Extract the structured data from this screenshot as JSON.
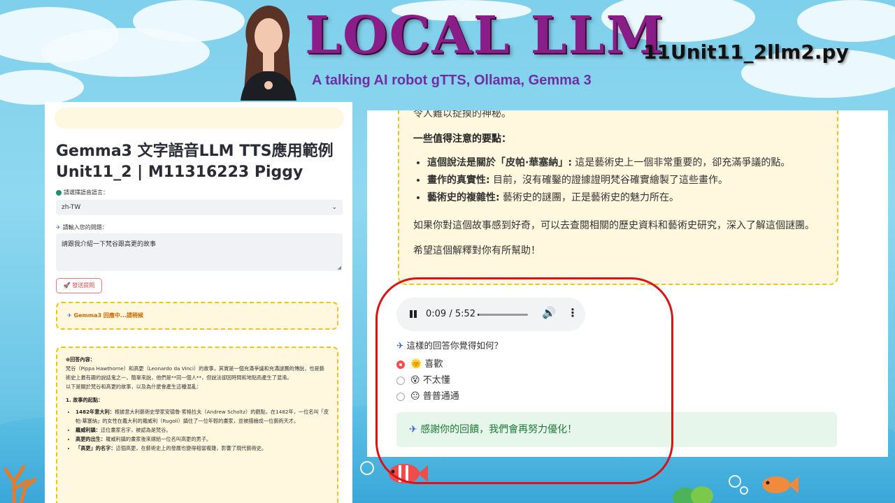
{
  "header": {
    "title": "LOCAL LLM",
    "subtitle": "A talking AI robot  gTTS, Ollama, Gemma 3",
    "filename": "11Unit11_2llm2.py"
  },
  "app": {
    "title_line1": "Gemma3 文字語音LLM TTS應用範例",
    "title_line2": "Unit11_2 | M11316223 Piggy",
    "language_label": "請選擇語音語言：",
    "language_value": "zh-TW",
    "question_label": "請輸入您的問題：",
    "question_value": "請跟我介紹一下梵谷跟高更的故事",
    "send_button": "發送提問",
    "status_text": "Gemma3 回應中...請稍候",
    "answer_heading": "回答內容：",
    "answer_p1": "梵谷（Pippa Hawthorne）和高更（Leonardo da Vinci）的故事，其實是一個充滿爭議和充滿謎團的傳說，也是藝術史上最有趣的說話鬼之一，簡單來說，他們是**同一個人**，但說法卻因時間和地點而產生了混淆。",
    "answer_p2": "以下是關於梵谷和高更的故事，以及為什麼會產生這種混亂：",
    "answer_section": "1. 故事的起點：",
    "answer_items": [
      {
        "bold": "1482年意大利：",
        "text": "根據意大利藝術史學家安德魯·索格拉夫（Andrew Scholtz）的觀點，在1482年，一位名叫「皮帕·華塞納」的女性在義大利的羅威利（Rugoli）鎮住了一位年輕的畫家，並被描繪成一位藝術天才。"
      },
      {
        "bold": "羅威利鎮：",
        "text": "這位畫家名字，被認為是梵谷。"
      },
      {
        "bold": "高更的出生：",
        "text": "羅威利鎮的畫家後來嫁給一位名叫高更的男子。"
      },
      {
        "bold": "「高更」的名字：",
        "text": "這個高更，在藝術史上的發展也變得相當複雜，影響了現代藝術史。"
      }
    ]
  },
  "response": {
    "clipped_line": "令人難以捉摸的神秘。",
    "heading": "一些值得注意的要點：",
    "points": [
      {
        "bold": "這個說法是關於「皮帕·華塞納」:",
        "text": " 這是藝術史上一個非常重要的，卻充滿爭議的點。"
      },
      {
        "bold": "畫作的真實性:",
        "text": " 目前，沒有確鑿的證據證明梵谷確實繪製了這些畫作。"
      },
      {
        "bold": "藝術史的複雜性:",
        "text": " 藝術史的謎團，正是藝術史的魅力所在。"
      }
    ],
    "p1": "如果你對這個故事感到好奇，可以去查閱相關的歷史資料和藝術史研究，深入了解這個謎團。",
    "p2": "希望這個解釋對你有所幫助！"
  },
  "audio": {
    "time": "0:09 / 5:52",
    "progress_fraction": 0.026
  },
  "feedback": {
    "question": "這樣的回答你覺得如何？",
    "options": [
      {
        "emoji": "🌞",
        "label": "喜歡",
        "selected": true
      },
      {
        "emoji": "😵",
        "label": "不太懂",
        "selected": false
      },
      {
        "emoji": "😐",
        "label": "普普通通",
        "selected": false
      }
    ],
    "thanks": "感謝你的回饋，我們會再努力優化！"
  },
  "colors": {
    "title": "#8a1e88",
    "accent_red": "#ff4b4b",
    "dashed_border": "#f0c419",
    "success_bg": "#e7f6ea"
  }
}
